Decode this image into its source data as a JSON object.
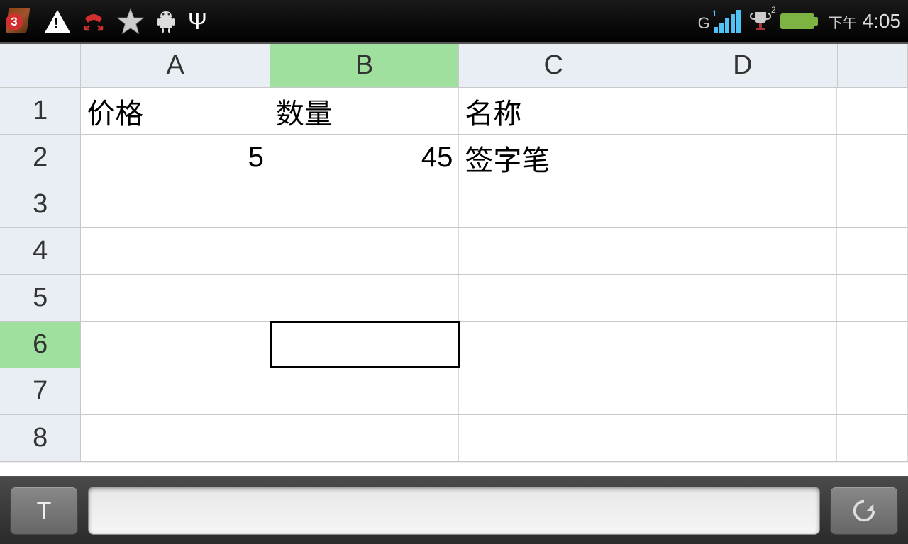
{
  "status_bar": {
    "notification_count": "3",
    "network_type": "G",
    "network_sup": "1",
    "trophy_sup": "2",
    "time_prefix": "下午",
    "time": "4:05"
  },
  "spreadsheet": {
    "columns": [
      "A",
      "B",
      "C",
      "D"
    ],
    "row_numbers": [
      "1",
      "2",
      "3",
      "4",
      "5",
      "6",
      "7",
      "8"
    ],
    "selected_column": "B",
    "selected_row": "6",
    "selected_cell": "B6",
    "cells": {
      "A1": "价格",
      "B1": "数量",
      "C1": "名称",
      "A2": "5",
      "B2": "45",
      "C2": "签字笔"
    }
  },
  "toolbar": {
    "text_button_label": "T",
    "formula_value": ""
  }
}
